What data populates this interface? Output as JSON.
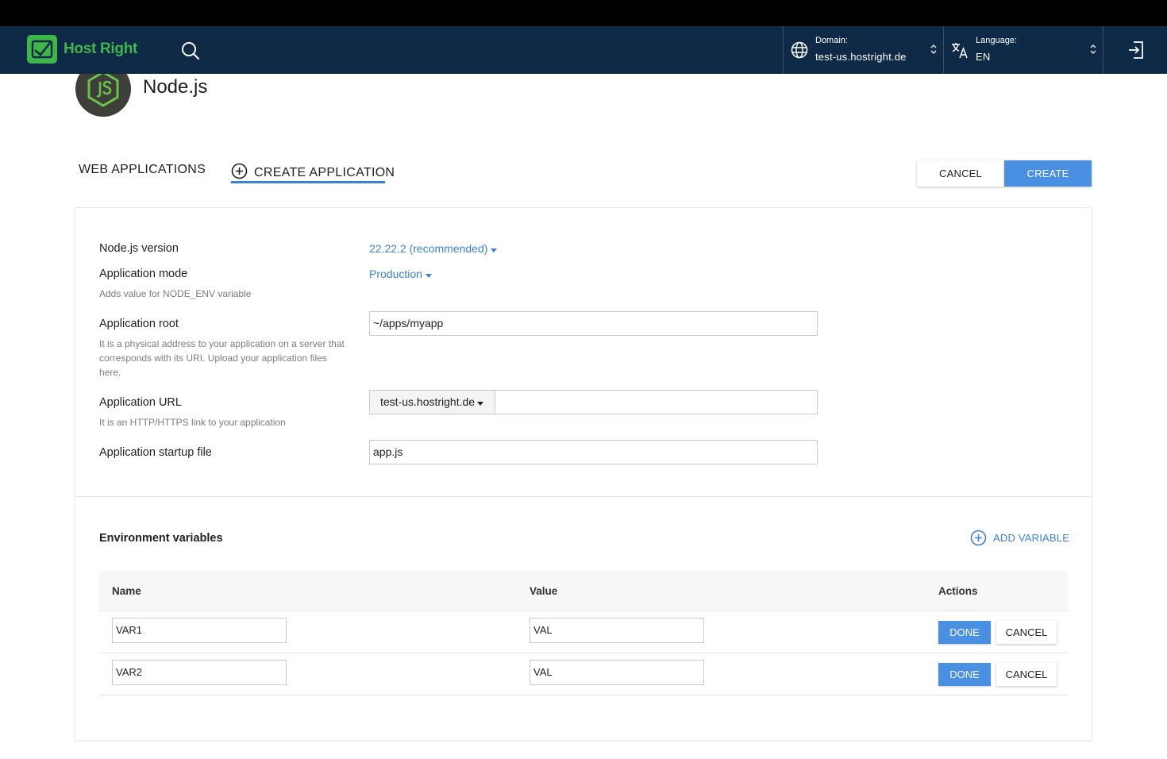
{
  "header": {
    "brand": "Host Right",
    "domain_label": "Domain:",
    "domain_value": "test-us.hostright.de",
    "language_label": "Language:",
    "language_value": "EN"
  },
  "app": {
    "title": "Node.js"
  },
  "tabs": [
    {
      "label": "WEB APPLICATIONS",
      "active": false
    },
    {
      "label": "CREATE APPLICATION",
      "active": true
    }
  ],
  "actions": {
    "cancel": "CANCEL",
    "create": "CREATE"
  },
  "form": {
    "version": {
      "label": "Node.js version",
      "value": "22.22.2 (recommended)"
    },
    "mode": {
      "label": "Application mode",
      "hint": "Adds value for NODE_ENV variable",
      "value": "Production"
    },
    "root": {
      "label": "Application root",
      "hint": "It is a physical address to your application on a server that corresponds with its URI. Upload your application files here.",
      "value": "~/apps/myapp"
    },
    "url": {
      "label": "Application URL",
      "hint": "It is an HTTP/HTTPS link to your application",
      "domain": "test-us.hostright.de",
      "path": ""
    },
    "startup": {
      "label": "Application startup file",
      "value": "app.js"
    }
  },
  "env": {
    "title": "Environment variables",
    "add_label": "ADD VARIABLE",
    "columns": {
      "name": "Name",
      "value": "Value",
      "actions": "Actions"
    },
    "rows": [
      {
        "name": "VAR1",
        "value": "VAL",
        "done": "DONE",
        "cancel": "CANCEL"
      },
      {
        "name": "VAR2",
        "value": "VAL",
        "done": "DONE",
        "cancel": "CANCEL"
      }
    ]
  },
  "colors": {
    "nav_bg": "#0e2a47",
    "brand_green": "#3fb649",
    "accent_blue": "#4a90e2",
    "link_blue": "#3b82d6"
  },
  "icons": [
    "search-icon",
    "globe-icon",
    "translate-icon",
    "sort-caret-icon",
    "logout-icon",
    "nodejs-icon",
    "plus-circle-icon",
    "caret-down-icon"
  ]
}
